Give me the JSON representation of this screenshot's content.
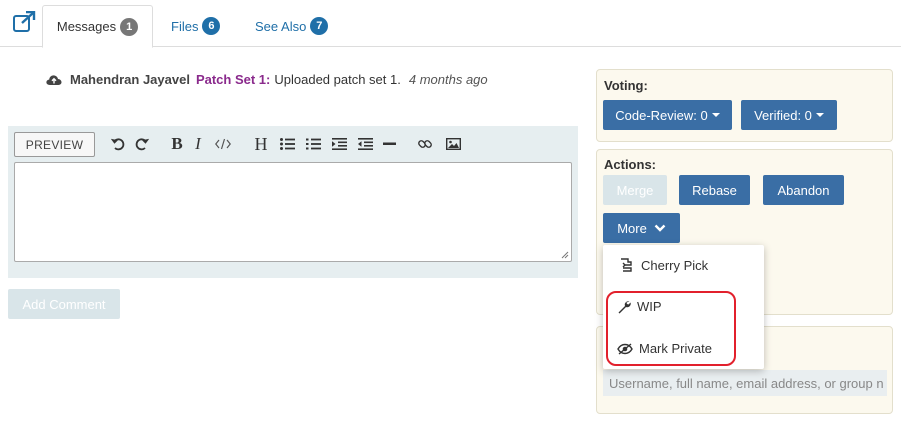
{
  "tabs": [
    {
      "label": "Messages",
      "count": "1"
    },
    {
      "label": "Files",
      "count": "6"
    },
    {
      "label": "See Also",
      "count": "7"
    }
  ],
  "message": {
    "author": "Mahendran Jayavel",
    "patch_set": "Patch Set 1:",
    "text": "Uploaded patch set 1.",
    "time": "4 months ago"
  },
  "editor": {
    "preview_label": "PREVIEW",
    "add_comment_label": "Add Comment",
    "toolbar_icons": [
      "undo-icon",
      "redo-icon",
      "bold-icon",
      "italic-icon",
      "code-icon",
      "heading-icon",
      "bullet-list-icon",
      "numbered-list-icon",
      "indent-icon",
      "outdent-icon",
      "horizontal-rule-icon",
      "link-icon",
      "image-icon"
    ]
  },
  "voting": {
    "title": "Voting:",
    "code_review_label": "Code-Review: 0",
    "verified_label": "Verified: 0"
  },
  "actions": {
    "title": "Actions:",
    "merge_label": "Merge",
    "rebase_label": "Rebase",
    "abandon_label": "Abandon",
    "more_label": "More",
    "menu": [
      {
        "label": "Cherry Pick",
        "icon": "cherry-pick-icon"
      },
      {
        "label": "WIP",
        "icon": "wrench-icon"
      },
      {
        "label": "Mark Private",
        "icon": "eye-slash-icon"
      }
    ]
  },
  "reviewers": {
    "placeholder": "Username, full name, email address, or group n"
  },
  "colors": {
    "accent": "#3a6ea5",
    "link": "#1f6fa8",
    "patch_set": "#8a2a8c",
    "panel_bg": "#fcf9ee",
    "highlight": "#e2202c"
  }
}
